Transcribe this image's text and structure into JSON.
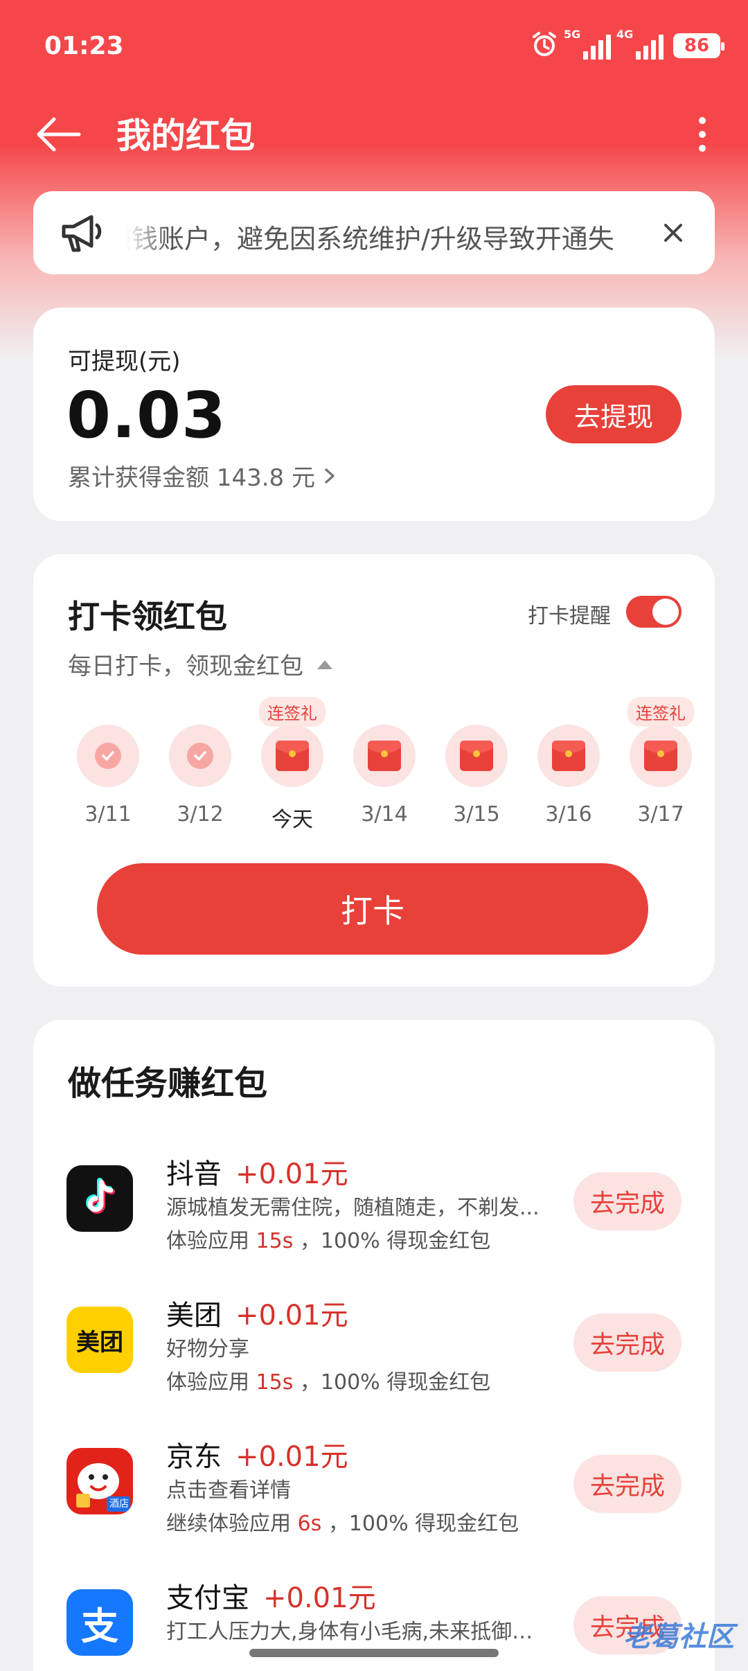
{
  "status_bar": {
    "time": "01:23",
    "signal_1_tag": "5G",
    "signal_2_tag": "4G",
    "battery": "86"
  },
  "header": {
    "title": "我的红包"
  },
  "notice": {
    "text": "赚钱账户，避免因系统维护/升级导致开通失"
  },
  "balance": {
    "label": "可提现(元)",
    "amount": "0.03",
    "total_text": "累计获得金额 143.8 元",
    "withdraw_label": "去提现"
  },
  "checkin": {
    "title": "打卡领红包",
    "subtitle": "每日打卡，领现金红包",
    "reminder_label": "打卡提醒",
    "reminder_on": true,
    "days": [
      {
        "date": "3/11",
        "state": "checked",
        "badge": ""
      },
      {
        "date": "3/12",
        "state": "checked",
        "badge": ""
      },
      {
        "date": "今天",
        "state": "packet",
        "badge": "连签礼"
      },
      {
        "date": "3/14",
        "state": "packet",
        "badge": ""
      },
      {
        "date": "3/15",
        "state": "packet",
        "badge": ""
      },
      {
        "date": "3/16",
        "state": "packet",
        "badge": ""
      },
      {
        "date": "3/17",
        "state": "packet",
        "badge": "连签礼"
      }
    ],
    "button_label": "打卡"
  },
  "tasks": {
    "title": "做任务赚红包",
    "items": [
      {
        "app": "抖音",
        "icon": "douyin-app-icon",
        "reward": "+0.01元",
        "desc": "源城植发无需住院，随植随走，不剃发...",
        "exp_prefix": "体验应用",
        "seconds": "15s",
        "exp_suffix": "，100% 得现金红包",
        "button": "去完成"
      },
      {
        "app": "美团",
        "icon": "meituan-app-icon",
        "icon_text": "美团",
        "reward": "+0.01元",
        "desc": "好物分享",
        "exp_prefix": "体验应用",
        "seconds": "15s",
        "exp_suffix": "，100% 得现金红包",
        "button": "去完成"
      },
      {
        "app": "京东",
        "icon": "jd-app-icon",
        "icon_text": "酒店",
        "reward": "+0.01元",
        "desc": "点击查看详情",
        "exp_prefix": "继续体验应用",
        "seconds": "6s",
        "exp_suffix": "，100% 得现金红包",
        "button": "去完成"
      },
      {
        "app": "支付宝",
        "icon": "alipay-app-icon",
        "icon_text": "支",
        "reward": "+0.01元",
        "desc": "打工人压力大,身体有小毛病,未来抵御风...",
        "button": "去完成"
      }
    ]
  },
  "watermark": {
    "text": "老葛社区"
  },
  "colors": {
    "primary": "#e8413a",
    "header_red": "#f5474a",
    "reward_red": "#d5322b",
    "light_pink": "#fbe3e2"
  }
}
